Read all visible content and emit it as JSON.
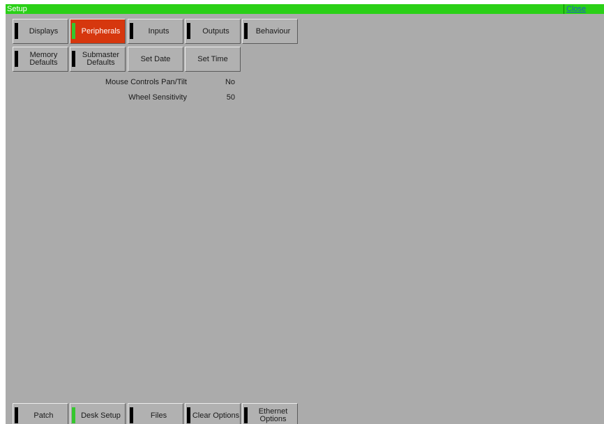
{
  "window": {
    "title": "Setup",
    "close_label": "Close",
    "titlebar_color": "#2ad017",
    "background_color": "#ababab"
  },
  "top_buttons": [
    {
      "label": "Displays",
      "indicator": "black",
      "active": false
    },
    {
      "label": "Peripherals",
      "indicator": "green",
      "active": true
    },
    {
      "label": "Inputs",
      "indicator": "black",
      "active": false
    },
    {
      "label": "Outputs",
      "indicator": "black",
      "active": false
    },
    {
      "label": "Behaviour",
      "indicator": "black",
      "active": false
    },
    {
      "label": "Memory Defaults",
      "indicator": "black",
      "active": false
    },
    {
      "label": "Submaster Defaults",
      "indicator": "black",
      "active": false
    },
    {
      "label": "Set Date",
      "indicator": "none",
      "active": false
    },
    {
      "label": "Set Time",
      "indicator": "none",
      "active": false
    }
  ],
  "settings": [
    {
      "label": "Mouse Controls Pan/Tilt",
      "value": "No"
    },
    {
      "label": "Wheel Sensitivity",
      "value": "50"
    }
  ],
  "bottom_buttons": [
    {
      "label": "Patch",
      "indicator": "black"
    },
    {
      "label": "Desk Setup",
      "indicator": "green"
    },
    {
      "label": "Files",
      "indicator": "black"
    },
    {
      "label": "Clear Options",
      "indicator": "black"
    },
    {
      "label": "Ethernet Options",
      "indicator": "black"
    }
  ],
  "colors": {
    "active_tab": "#d6370e",
    "indicator_green": "#34c72d",
    "indicator_black": "#000000"
  }
}
